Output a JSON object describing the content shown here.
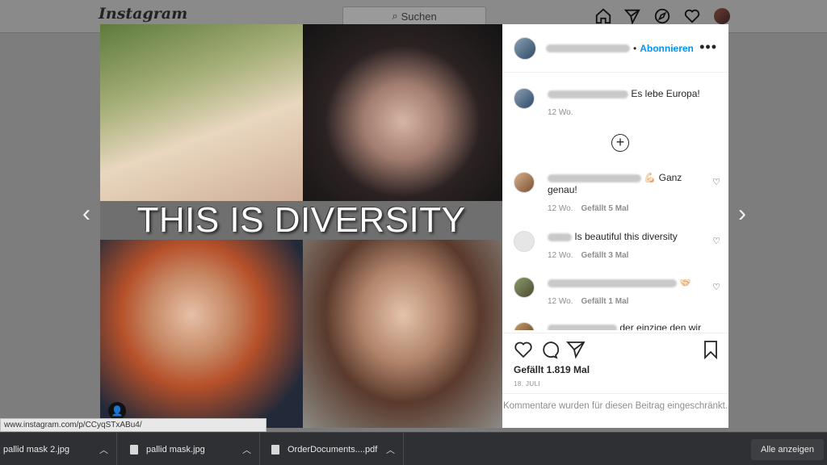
{
  "header": {
    "logo": "Instagram",
    "search_placeholder": "Suchen"
  },
  "post": {
    "banner_text": "THIS IS DIVERSITY",
    "follow_label": "Abonnieren",
    "caption_text": "Es lebe Europa!",
    "caption_time": "12 Wo.",
    "likes": "Gefällt 1.819 Mal",
    "date": "18. JULI",
    "restricted_notice": "Kommentare wurden für diesen Beitrag eingeschränkt."
  },
  "comments": [
    {
      "text": "💪🏻 Ganz genau!",
      "time": "12 Wo.",
      "likes": "Gefällt 5 Mal"
    },
    {
      "text": "Is beautiful this diversity",
      "time": "12 Wo.",
      "likes": "Gefällt 3 Mal"
    },
    {
      "text": "🤝🏻",
      "time": "12 Wo.",
      "likes": "Gefällt 1 Mal"
    },
    {
      "text": "der einzige den wir",
      "time": "",
      "likes": ""
    }
  ],
  "status_url": "www.instagram.com/p/CCyqSTxABu4/",
  "downloads": {
    "items": [
      {
        "name": "pallid mask 2.jpg"
      },
      {
        "name": "pallid mask.jpg"
      },
      {
        "name": "OrderDocuments....pdf"
      }
    ],
    "show_all": "Alle anzeigen"
  },
  "colors": {
    "accent": "#0095f6",
    "text": "#262626",
    "muted": "#8e8e8e",
    "download_bar": "#2f3034"
  }
}
